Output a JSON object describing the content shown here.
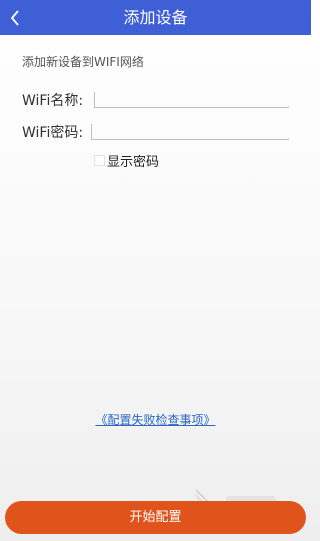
{
  "header": {
    "title": "添加设备",
    "back_icon": "chevron-left-icon",
    "color": "#3f5fd6"
  },
  "form": {
    "subtitle": "添加新设备到WIFI网络",
    "wifi_name_label": "WiFi名称:",
    "wifi_name_value": "",
    "wifi_password_label": "WiFi密码:",
    "wifi_password_value": "",
    "show_password_label": "显示密码",
    "show_password_checked": false
  },
  "help_link": "《配置失败检查事项》",
  "start_button": {
    "label": "开始配置",
    "color": "#e0541b"
  }
}
